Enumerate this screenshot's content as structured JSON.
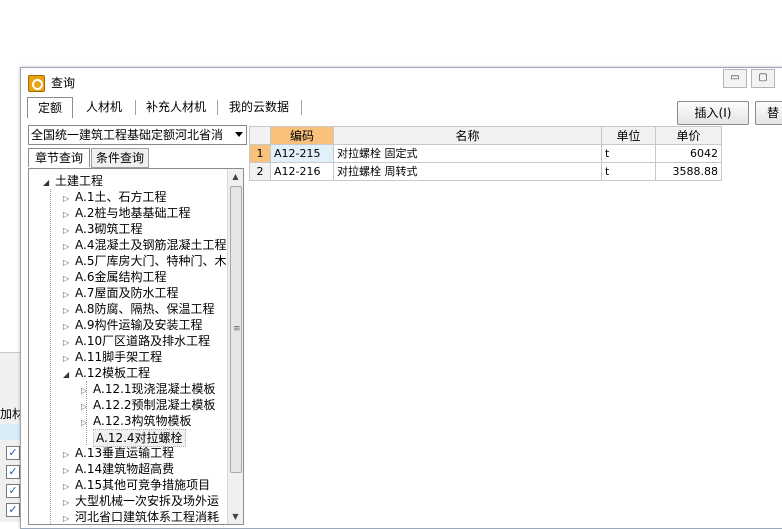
{
  "background": {
    "label": "加材",
    "checks": [
      "✓",
      "✓",
      "✓",
      "✓"
    ]
  },
  "window": {
    "title": "查询",
    "controls": {
      "minimize": "▭",
      "maximize": "▢"
    }
  },
  "tabs": [
    "定额",
    "人材机",
    "补充人材机",
    "我的云数据"
  ],
  "buttons": {
    "insert": "插入(I)",
    "replace": "替"
  },
  "combo": {
    "value": "全国统一建筑工程基础定额河北省消"
  },
  "subtabs": [
    "章节查询",
    "条件查询"
  ],
  "tree": {
    "root": "土建工程",
    "items": [
      "A.1土、石方工程",
      "A.2桩与地基基础工程",
      "A.3砌筑工程",
      "A.4混凝土及钢筋混凝土工程",
      "A.5厂库房大门、特种门、木",
      "A.6金属结构工程",
      "A.7屋面及防水工程",
      "A.8防腐、隔热、保温工程",
      "A.9构件运输及安装工程",
      "A.10厂区道路及排水工程",
      "A.11脚手架工程",
      "A.12模板工程"
    ],
    "sub_items": [
      "A.12.1现浇混凝土模板",
      "A.12.2预制混凝土模板",
      "A.12.3构筑物模板",
      "A.12.4对拉螺栓"
    ],
    "after_items": [
      "A.13垂直运输工程",
      "A.14建筑物超高费",
      "A.15其他可竞争措施项目",
      "大型机械一次安拆及场外运",
      "河北省口建筑体系工程消耗"
    ]
  },
  "grid": {
    "columns": [
      "编码",
      "名称",
      "单位",
      "单价"
    ],
    "rows": [
      {
        "num": "1",
        "code": "A12-215",
        "name": "对拉螺栓 固定式",
        "unit": "t",
        "price": "6042"
      },
      {
        "num": "2",
        "code": "A12-216",
        "name": "对拉螺栓 周转式",
        "unit": "t",
        "price": "3588.88"
      }
    ]
  },
  "colors": {
    "header_selected": "#f8c27c",
    "cell_selected": "#e2f0fa"
  }
}
